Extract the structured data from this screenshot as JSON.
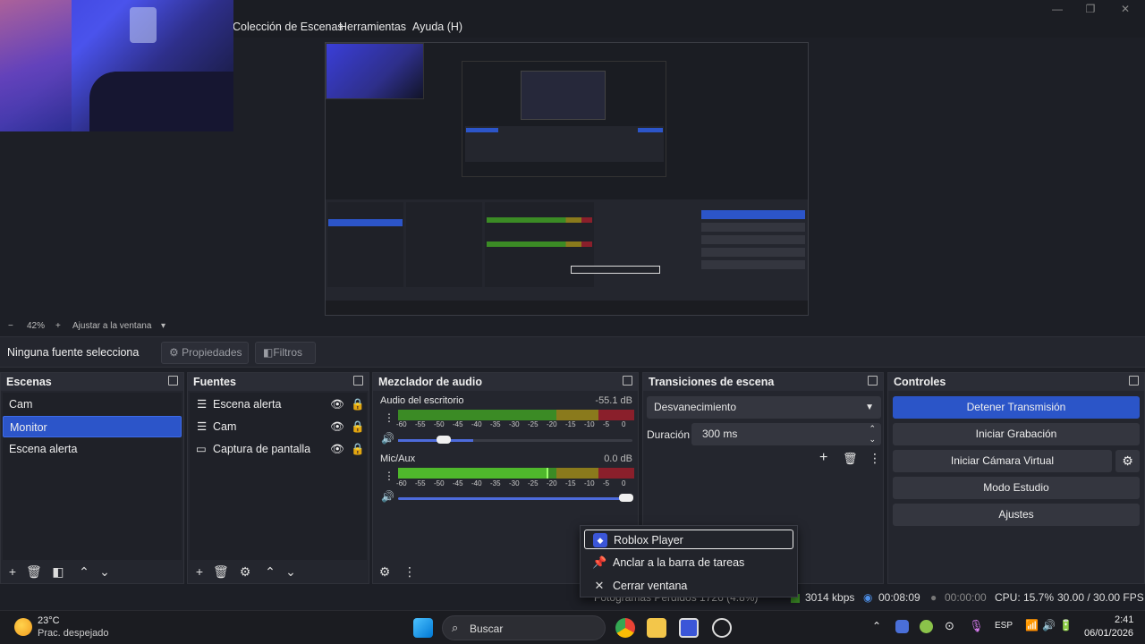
{
  "menu": {
    "items": [
      "Colección de Escenas",
      "Herramientas",
      "Ayuda (H)"
    ]
  },
  "zoom": {
    "minus": "−",
    "value": "42%",
    "plus": "+",
    "fit_label": "Ajustar a la ventana"
  },
  "source_bar": {
    "status": "Ninguna fuente selecciona",
    "properties": "Propiedades",
    "filters": "Filtros"
  },
  "scenes": {
    "title": "Escenas",
    "items": [
      {
        "label": "Cam",
        "selected": false
      },
      {
        "label": "Monitor",
        "selected": true
      },
      {
        "label": "Escena alerta",
        "selected": false
      }
    ]
  },
  "sources": {
    "title": "Fuentes",
    "items": [
      {
        "label": "Escena alerta",
        "icon": "list-icon"
      },
      {
        "label": "Cam",
        "icon": "list-icon"
      },
      {
        "label": "Captura de pantalla",
        "icon": "monitor-icon"
      }
    ]
  },
  "mixer": {
    "title": "Mezclador de audio",
    "channels": [
      {
        "name": "Audio del escritorio",
        "db": "-55.1 dB",
        "level": 0.0,
        "volume": 0.32
      },
      {
        "name": "Mic/Aux",
        "db": "0.0 dB",
        "level": 0.63,
        "volume": 1.0
      }
    ],
    "ticks": [
      "-60",
      "-55",
      "-50",
      "-45",
      "-40",
      "-35",
      "-30",
      "-25",
      "-20",
      "-15",
      "-10",
      "-5",
      "0"
    ]
  },
  "transitions": {
    "title": "Transiciones de escena",
    "selected": "Desvanecimiento",
    "duration_label": "Duración",
    "duration_value": "300 ms"
  },
  "controls": {
    "title": "Controles",
    "stop_stream": "Detener Transmisión",
    "start_recording": "Iniciar Grabación",
    "start_virtual_cam": "Iniciar Cámara Virtual",
    "studio_mode": "Modo Estudio",
    "settings": "Ajustes"
  },
  "status": {
    "dropped": "Fotogramas Perdidos 1726 (4.8%)",
    "kbps": "3014 kbps",
    "stream_time": "00:08:09",
    "rec_time": "00:00:00",
    "cpu": "CPU: 15.7%",
    "fps": "30.00 / 30.00 FPS"
  },
  "context_menu": {
    "items": [
      "Roblox Player",
      "Anclar a la barra de tareas",
      "Cerrar ventana"
    ]
  },
  "taskbar": {
    "weather_temp": "23°C",
    "weather_desc": "Prac. despejado",
    "search": "Buscar",
    "lang": "ESP",
    "time": "2:41",
    "date": "06/01/2026"
  },
  "colors": {
    "accent": "#2b55c8",
    "meter_green": "#3b8b25",
    "meter_yellow": "#8a7a1c",
    "meter_red": "#8a1f2b"
  }
}
